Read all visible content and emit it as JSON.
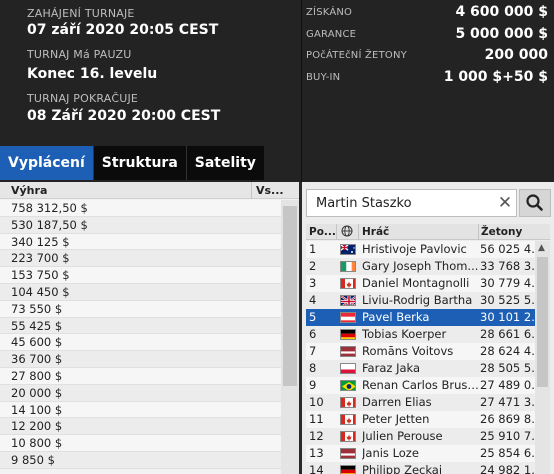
{
  "info": {
    "start_label": "ZAHÁJENÍ TURNAJE",
    "start_value": "07 září 2020  20:05 CEST",
    "pause_label": "TURNAJ Má PAUZU",
    "pause_value": "Konec 16. levelu",
    "resume_label": "TURNAJ POKRAČUJE",
    "resume_value": "08 Září 2020  20:00 CEST",
    "stats": [
      {
        "label": "ZÍSKÁNO",
        "value": "4 600 000 $"
      },
      {
        "label": "GARANCE",
        "value": "5 000 000 $"
      },
      {
        "label": "POčÁTEčNÍ ŽETONY",
        "value": "200 000"
      },
      {
        "label": "BUY-IN",
        "value": "1 000 $+50 $"
      }
    ]
  },
  "tabs": [
    {
      "label": "Vyplácení",
      "active": true
    },
    {
      "label": "Struktura",
      "active": false
    },
    {
      "label": "Satelity",
      "active": false
    }
  ],
  "payout": {
    "col_prize": "Výhra",
    "col_vs": "Vs...",
    "rows": [
      "758 312,50 $",
      "530 187,50 $",
      "340 125 $",
      "223 700 $",
      "153 750 $",
      "104 450 $",
      "73 550 $",
      "55 425 $",
      "45 600 $",
      "36 700 $",
      "27 800 $",
      "20 000 $",
      "14 100 $",
      "12 200 $",
      "10 800 $",
      "9 850 $"
    ]
  },
  "players": {
    "search_value": "Martin Staszko",
    "col_pos": "Po...",
    "col_player": "Hráč",
    "col_chips": "Žetony",
    "rows": [
      {
        "pos": "1",
        "name": "Hristivoje Pavlovic",
        "chips": "56 025 4...",
        "flag": "au"
      },
      {
        "pos": "2",
        "name": "Gary Joseph Thom...",
        "chips": "33 768 3...",
        "flag": "ie"
      },
      {
        "pos": "3",
        "name": "Daniel Montagnolli",
        "chips": "30 779 4...",
        "flag": "ca"
      },
      {
        "pos": "4",
        "name": "Liviu-Rodrig Bartha",
        "chips": "30 525 5...",
        "flag": "gb"
      },
      {
        "pos": "5",
        "name": "Pavel Berka",
        "chips": "30 101 2...",
        "flag": "at",
        "selected": true
      },
      {
        "pos": "6",
        "name": "Tobias Koerper",
        "chips": "28 661 6...",
        "flag": "de"
      },
      {
        "pos": "7",
        "name": "Romāns Voitovs",
        "chips": "28 624 4...",
        "flag": "lv"
      },
      {
        "pos": "8",
        "name": "Faraz Jaka",
        "chips": "28 505 5...",
        "flag": "pl"
      },
      {
        "pos": "9",
        "name": "Renan Carlos Brusch",
        "chips": "27 489 0...",
        "flag": "br"
      },
      {
        "pos": "10",
        "name": "Darren Elias",
        "chips": "27 471 3...",
        "flag": "ca"
      },
      {
        "pos": "11",
        "name": "Peter Jetten",
        "chips": "26 869 8...",
        "flag": "ca"
      },
      {
        "pos": "12",
        "name": "Julien Perouse",
        "chips": "25 910 7...",
        "flag": "ca"
      },
      {
        "pos": "13",
        "name": "Janis Loze",
        "chips": "25 854 6...",
        "flag": "lv"
      },
      {
        "pos": "14",
        "name": "Philipp Zeckai",
        "chips": "24 982 1...",
        "flag": "de"
      }
    ]
  }
}
